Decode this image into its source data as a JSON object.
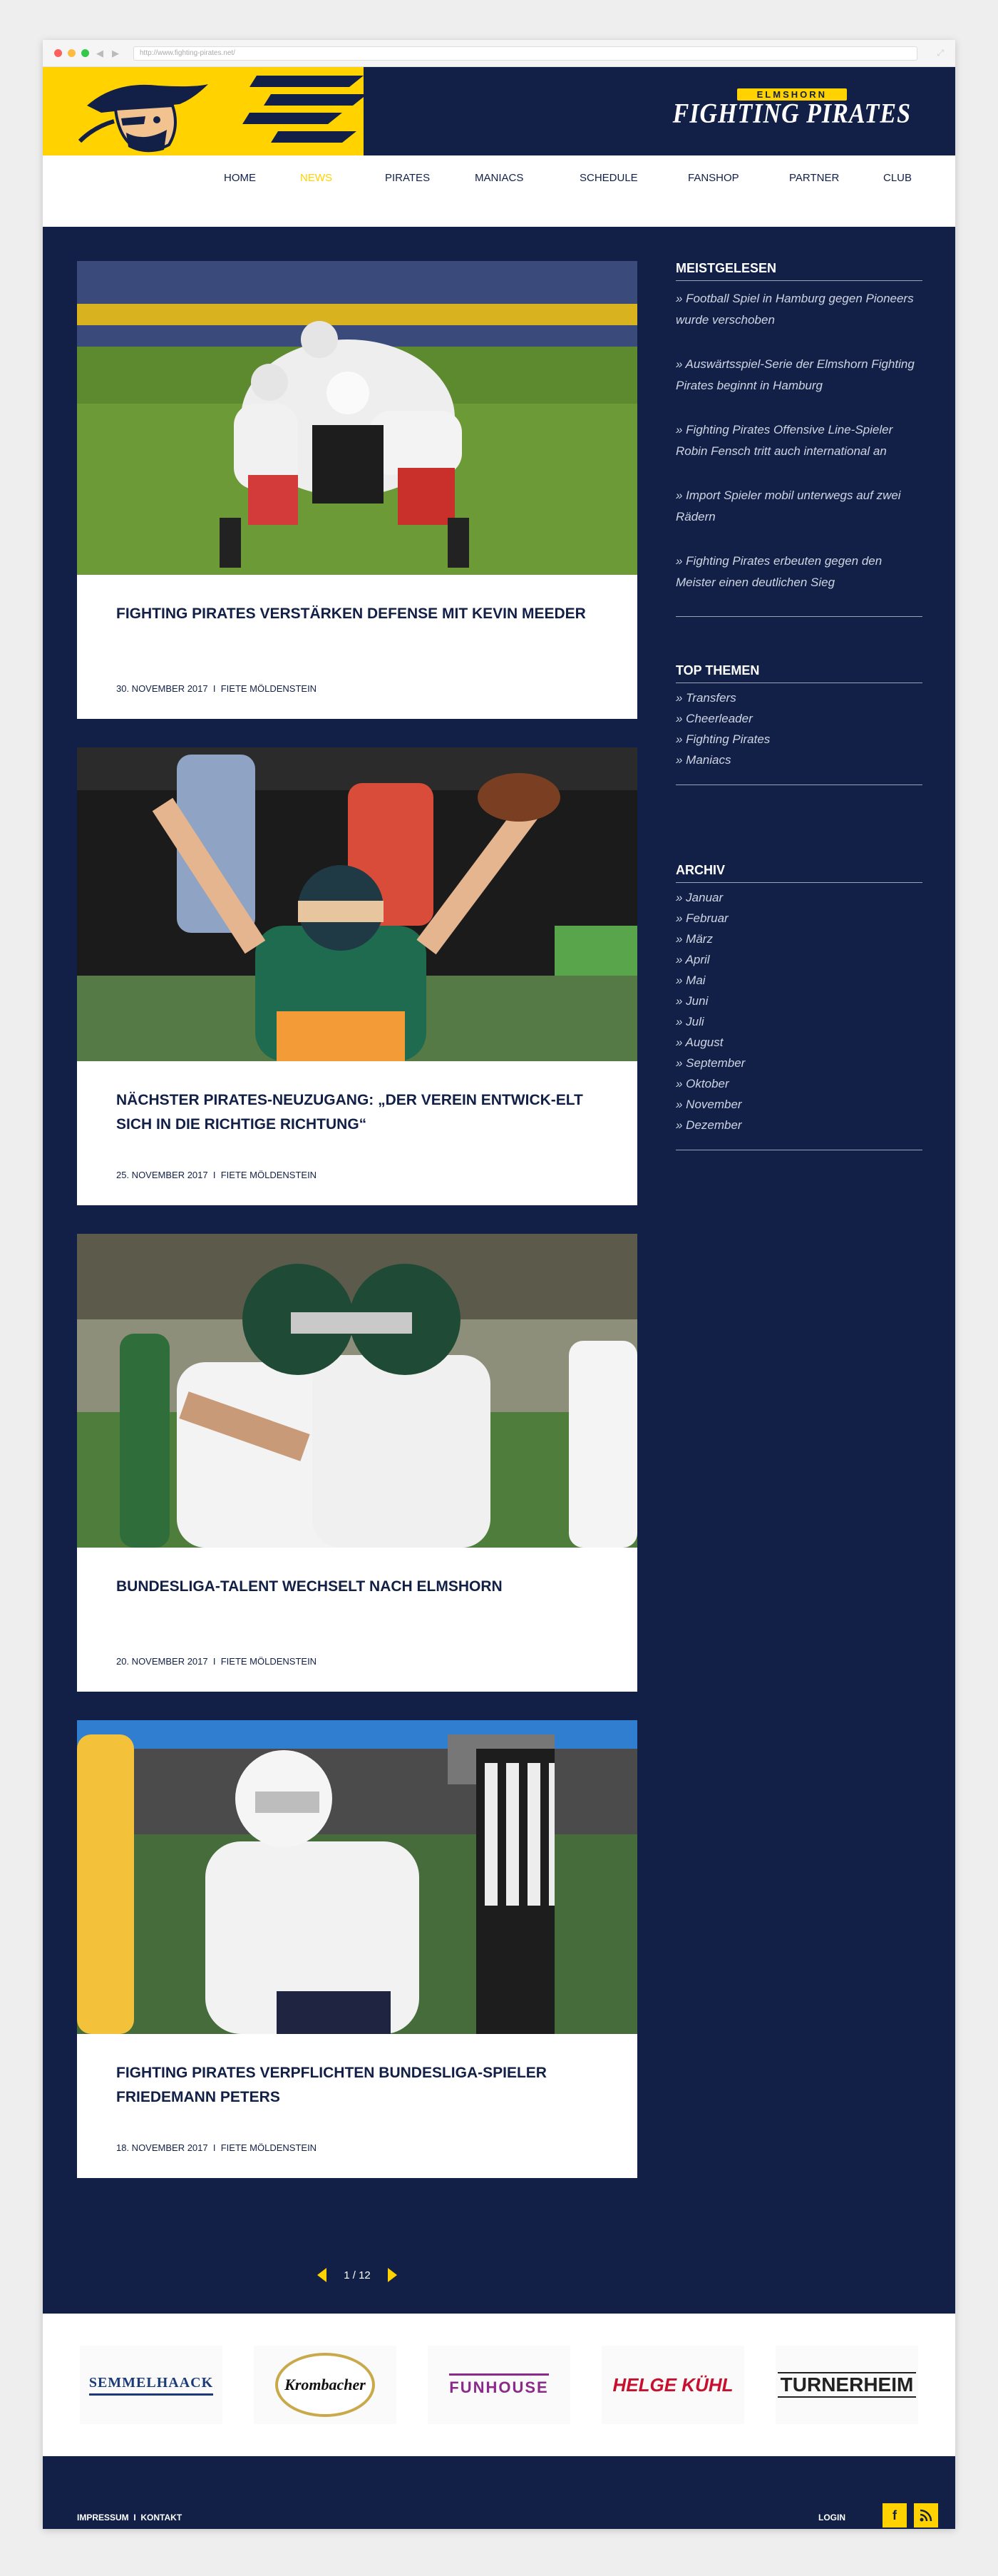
{
  "browser": {
    "url": "http://www.fighting-pirates.net/"
  },
  "brand": {
    "logo_top": "ELMSHORN",
    "logo_bottom": "FIGHTING PIRATES"
  },
  "nav": {
    "items": [
      {
        "label": "HOME",
        "active": false
      },
      {
        "label": "NEWS",
        "active": true
      },
      {
        "label": "PIRATES",
        "active": false
      },
      {
        "label": "MANIACS",
        "active": false
      },
      {
        "label": "SCHEDULE",
        "active": false
      },
      {
        "label": "FANSHOP",
        "active": false
      },
      {
        "label": "PARTNER",
        "active": false
      },
      {
        "label": "CLUB",
        "active": false
      }
    ]
  },
  "posts": [
    {
      "title": "FIGHTING PIRATES VERSTÄRKEN DEFENSE MIT KEVIN MEEDER",
      "date": "30. NOVEMBER 2017",
      "author": "FIETE MÖLDENSTEIN"
    },
    {
      "title": "NÄCHSTER PIRATES-NEUZUGANG: „DER VEREIN ENTWICK-ELT SICH IN DIE RICHTIGE RICHTUNG“",
      "date": "25. NOVEMBER 2017",
      "author": "FIETE MÖLDENSTEIN"
    },
    {
      "title": "BUNDESLIGA-TALENT WECHSELT NACH ELMSHORN",
      "date": "20. NOVEMBER 2017",
      "author": "FIETE MÖLDENSTEIN"
    },
    {
      "title": "FIGHTING PIRATES VERPFLICHTEN BUNDESLIGA-SPIELER FRIEDEMANN PETERS",
      "date": "18. NOVEMBER 2017",
      "author": "FIETE MÖLDENSTEIN"
    }
  ],
  "meta_sep": "I",
  "sidebar": {
    "meistgelesen": {
      "title": "MEISTGELESEN",
      "items": [
        "» Football Spiel in Hamburg gegen Pioneers wurde verschoben",
        "» Auswärtsspiel-Serie der Elmshorn Fighting Pirates beginnt in Hamburg",
        "» Fighting Pirates Offensive Line-Spieler Robin Fensch tritt auch international an",
        "» Import Spieler mobil unterwegs auf zwei Rädern",
        "» Fighting Pirates erbeuten gegen den Meister einen deutlichen Sieg"
      ]
    },
    "top_themen": {
      "title": "TOP THEMEN",
      "items": [
        "» Transfers",
        "» Cheerleader",
        "» Fighting Pirates",
        "» Maniacs"
      ]
    },
    "archiv": {
      "title": "ARCHIV",
      "items": [
        "» Januar",
        "» Februar",
        "» März",
        "» April",
        "» Mai",
        "» Juni",
        "» Juli",
        "» August",
        "» September",
        "» Oktober",
        "» November",
        "» Dezember"
      ]
    }
  },
  "pagination": {
    "label": "1 / 12"
  },
  "sponsors": [
    "SEMMELHAACK",
    "Krombacher",
    "FUNHOUSE",
    "HELGE KÜHL",
    "TURNERHEIM"
  ],
  "footer": {
    "impressum": "IMPRESSUM",
    "sep": "I",
    "kontakt": "KONTAKT",
    "login": "LOGIN"
  },
  "colors": {
    "navy": "#122047",
    "yellow": "#ffd200"
  },
  "icons": {
    "facebook": "facebook-icon",
    "rss": "rss-icon"
  }
}
